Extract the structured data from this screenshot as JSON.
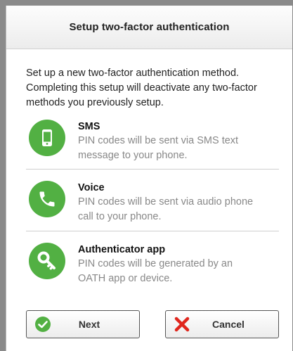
{
  "dialog": {
    "title": "Setup two-factor authentication",
    "intro": "Set up a new two-factor authentication method. Completing this setup will deactivate any two-factor methods you previously setup."
  },
  "methods": [
    {
      "title": "SMS",
      "description": "PIN codes will be sent via SMS text message to your phone.",
      "icon": "phone-icon"
    },
    {
      "title": "Voice",
      "description": "PIN codes will be sent via audio phone call to your phone.",
      "icon": "handset-icon"
    },
    {
      "title": "Authenticator app",
      "description": "PIN codes will be generated by an OATH app or device.",
      "icon": "key-icon"
    }
  ],
  "buttons": {
    "next_label": "Next",
    "cancel_label": "Cancel"
  },
  "colors": {
    "accent": "#52b043",
    "cancel": "#e0261d"
  }
}
